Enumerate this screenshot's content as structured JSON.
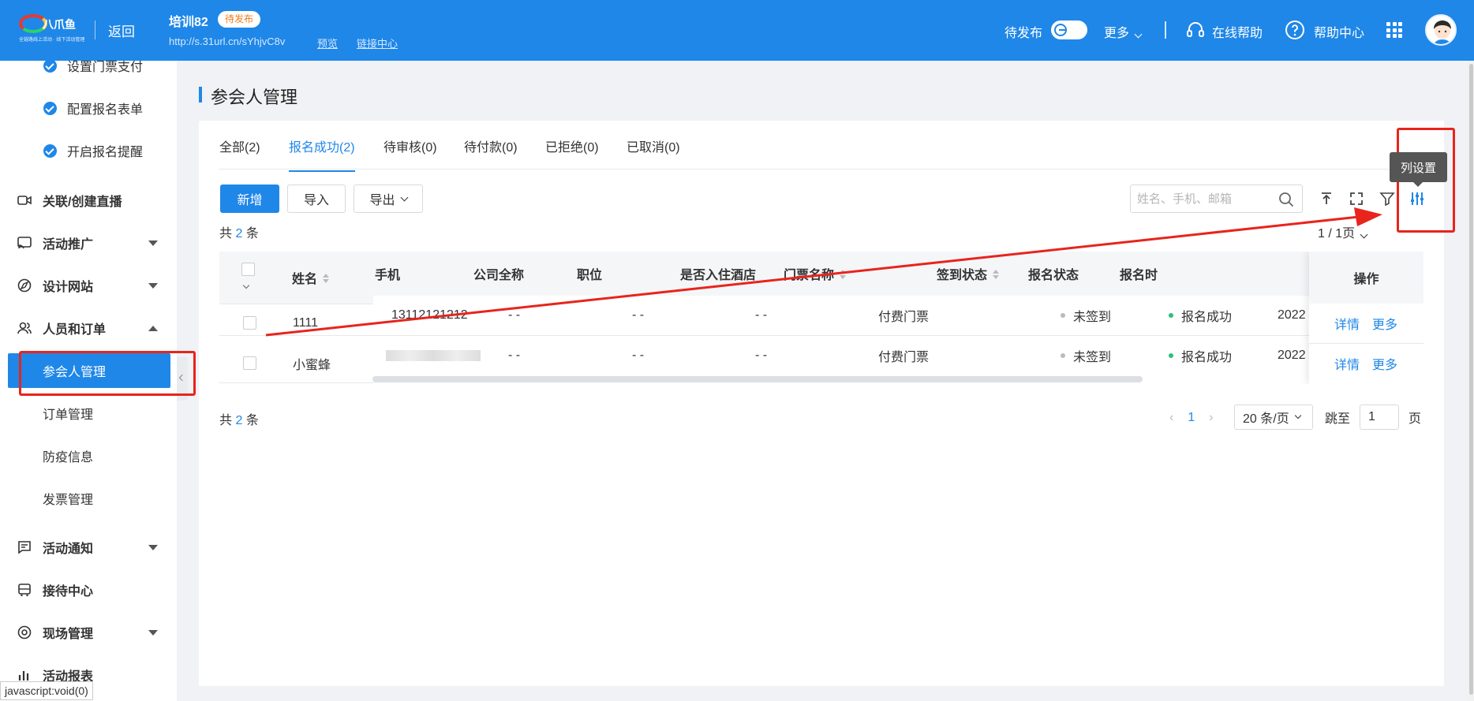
{
  "header": {
    "logo_text": "八爪鱼",
    "logo_tagline": "全链路线上活动 · 线下活动管理",
    "back": "返回",
    "event_title": "培训82",
    "event_status": "待发布",
    "event_url": "http://s.31url.cn/sYhjvC8v",
    "preview": "预览",
    "link_center": "链接中心",
    "publish_label": "待发布",
    "more": "更多",
    "online_help": "在线帮助",
    "help_center": "帮助中心"
  },
  "sidebar": {
    "steps": [
      "设置门票支付",
      "配置报名表单",
      "开启报名提醒"
    ],
    "groups": [
      {
        "label": "关联/创建直播",
        "icon": "video-icon",
        "arrow": false
      },
      {
        "label": "活动推广",
        "icon": "broadcast-icon",
        "arrow": true
      },
      {
        "label": "设计网站",
        "icon": "compass-icon",
        "arrow": true
      },
      {
        "label": "人员和订单",
        "icon": "people-icon",
        "arrow": "up"
      }
    ],
    "sub_items": [
      "参会人管理",
      "订单管理",
      "防疫信息",
      "发票管理"
    ],
    "groups2": [
      {
        "label": "活动通知",
        "icon": "message-icon",
        "arrow": true
      },
      {
        "label": "接待中心",
        "icon": "bus-icon",
        "arrow": false
      },
      {
        "label": "现场管理",
        "icon": "target-icon",
        "arrow": true
      },
      {
        "label": "活动报表",
        "icon": "bar-chart-icon",
        "arrow": false
      }
    ]
  },
  "status_bar": "javascript:void(0)",
  "page": {
    "title": "参会人管理",
    "tabs": [
      "全部(2)",
      "报名成功(2)",
      "待审核(0)",
      "待付款(0)",
      "已拒绝(0)",
      "已取消(0)"
    ],
    "active_tab": 1,
    "buttons": {
      "add": "新增",
      "import": "导入",
      "export": "导出"
    },
    "search_placeholder": "姓名、手机、邮箱",
    "total_prefix": "共",
    "total_count": "2",
    "total_suffix": "条",
    "page_small": "1 / 1页",
    "tooltip": "列设置"
  },
  "table": {
    "columns": [
      "姓名",
      "手机",
      "公司全称",
      "职位",
      "是否入住酒店",
      "门票名称",
      "签到状态",
      "报名状态",
      "报名时",
      "操作"
    ],
    "rows": [
      {
        "name": "1111",
        "phone": "13112121212",
        "company": "- -",
        "position": "- -",
        "hotel": "- -",
        "ticket": "付费门票",
        "checkin": "未签到",
        "status": "报名成功",
        "time": "2022",
        "detail": "详情",
        "more": "更多"
      },
      {
        "name": "小蜜蜂",
        "phone": "",
        "company": "- -",
        "position": "- -",
        "hotel": "- -",
        "ticket": "付费门票",
        "checkin": "未签到",
        "status": "报名成功",
        "time": "2022",
        "detail": "详情",
        "more": "更多"
      }
    ]
  },
  "pagination": {
    "current": "1",
    "page_size": "20 条/页",
    "jump_label": "跳至",
    "jump_value": "1",
    "page_unit": "页"
  },
  "colors": {
    "primary": "#1f87e8",
    "annotation": "#e8241c",
    "success_dot": "#2bbf7a",
    "idle_dot": "#bbbbbb"
  }
}
